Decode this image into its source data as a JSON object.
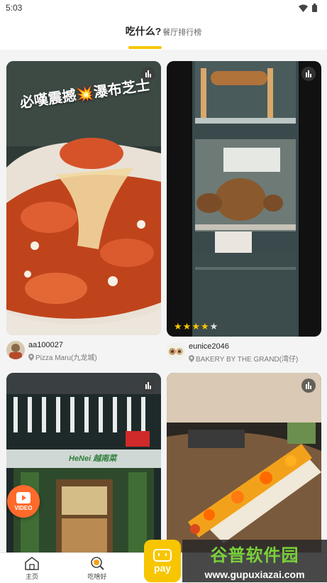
{
  "status_bar": {
    "time": "5:03",
    "icons": [
      "wifi-icon",
      "battery-icon"
    ]
  },
  "header": {
    "tab_active": "吃什么?",
    "tab_other": "餐厅排行榜"
  },
  "cards": [
    {
      "overlay_text": "必嘆震撼💥瀑布芝士",
      "username": "aa100027",
      "place": "Pizza Maru(九龙城)"
    },
    {
      "rating": 4,
      "rating_max": 5,
      "username": "eunice2046",
      "place": "BAKERY BY THE GRAND(湾仔)"
    },
    {
      "sign_text": "HeNei 越南菜"
    },
    {}
  ],
  "floating": {
    "video_label": "VIDEO"
  },
  "bottom_nav": {
    "items": [
      {
        "label": "主页",
        "icon": "home-icon"
      },
      {
        "label": "吃啥好",
        "icon": "search-food-icon"
      }
    ]
  },
  "watermark": {
    "badge": "pay",
    "text": "谷普软件园",
    "url": "www.gupuxiazai.com"
  },
  "colors": {
    "accent": "#f7c600",
    "video": "#ff6a2b"
  }
}
